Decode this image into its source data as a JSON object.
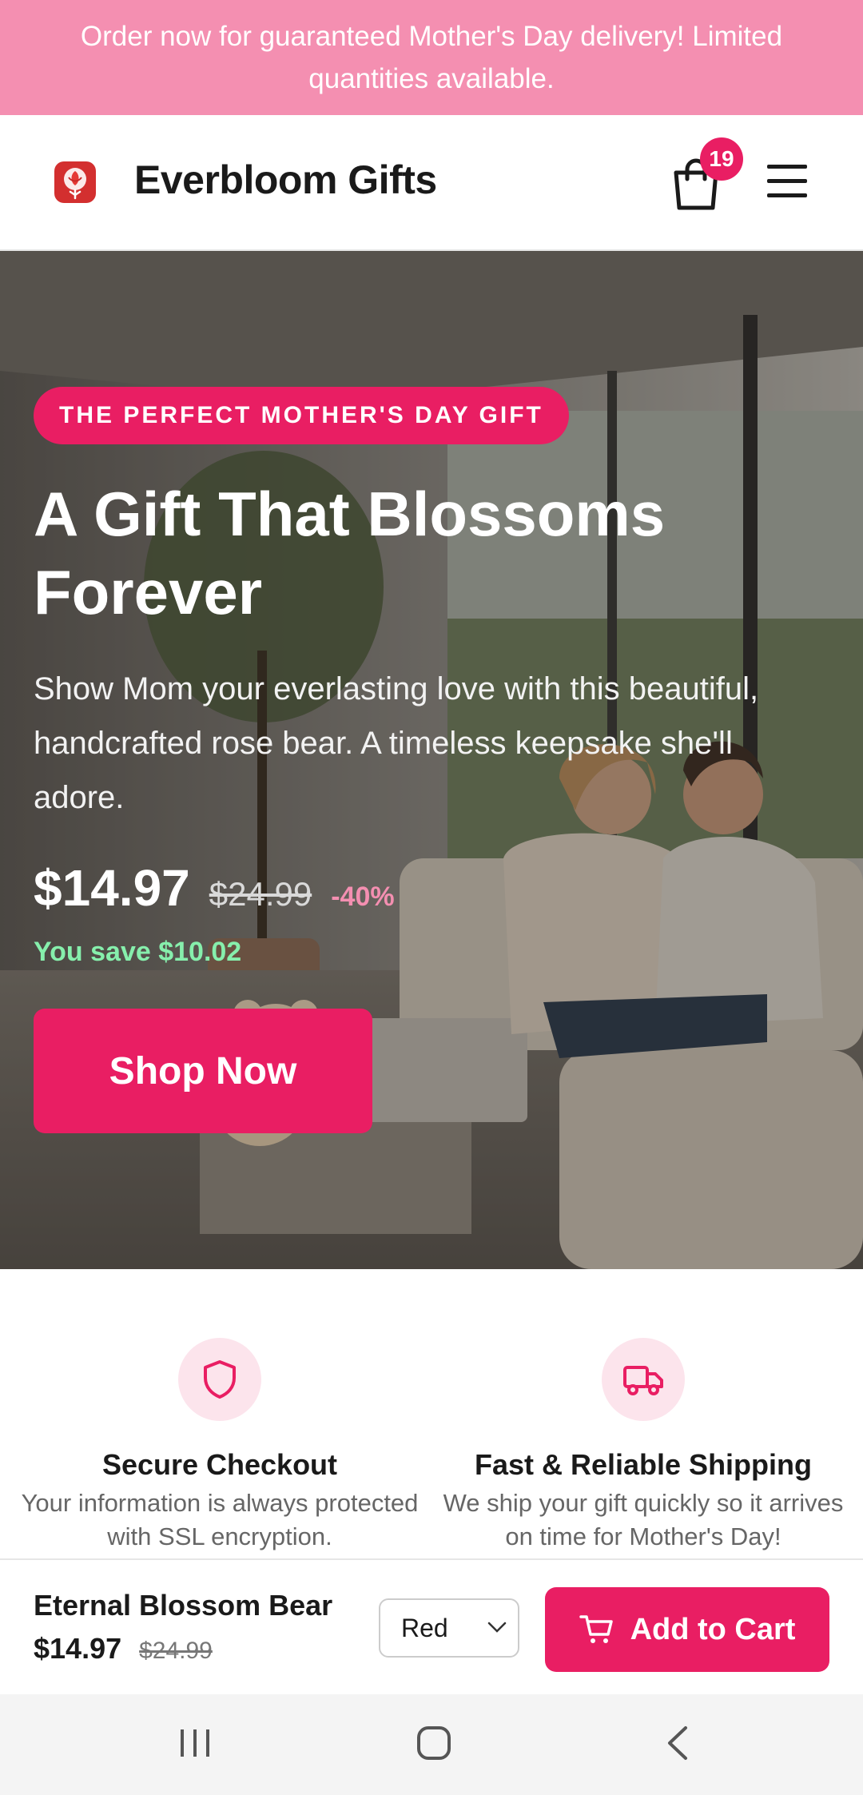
{
  "announcement": {
    "text": "Order now for guaranteed Mother's Day delivery! Limited quantities available."
  },
  "header": {
    "brand": "Everbloom Gifts",
    "cart_count": "19",
    "logo_icon": "rose-logo-icon",
    "cart_icon": "shopping-bag-icon",
    "menu_icon": "hamburger-menu-icon"
  },
  "hero": {
    "tag": "THE PERFECT MOTHER'S DAY GIFT",
    "title": "A Gift That Blossoms Forever",
    "description": "Show Mom your everlasting love with this beautiful, handcrafted rose bear. A timeless keepsake she'll adore.",
    "price_now": "$14.97",
    "price_was": "$24.99",
    "discount": "-40%",
    "savings": "You save $10.02",
    "cta": "Shop Now"
  },
  "features": [
    {
      "icon": "shield-icon",
      "title": "Secure Checkout",
      "text": "Your information is always protected with SSL encryption."
    },
    {
      "icon": "truck-icon",
      "title": "Fast & Reliable Shipping",
      "text": "We ship your gift quickly so it arrives on time for Mother's Day!"
    }
  ],
  "sticky_bar": {
    "product_name": "Eternal Blossom Bear",
    "price_now": "$14.97",
    "price_was": "$24.99",
    "variant_selected": "Red",
    "add_to_cart": "Add to Cart"
  },
  "colors": {
    "accent": "#e91e63",
    "announcement_bg": "#f48fb1",
    "savings": "#86efac",
    "icon_bg": "#fce4ec"
  },
  "system_nav": {
    "buttons": [
      "recent-apps-icon",
      "home-icon",
      "back-icon"
    ]
  }
}
